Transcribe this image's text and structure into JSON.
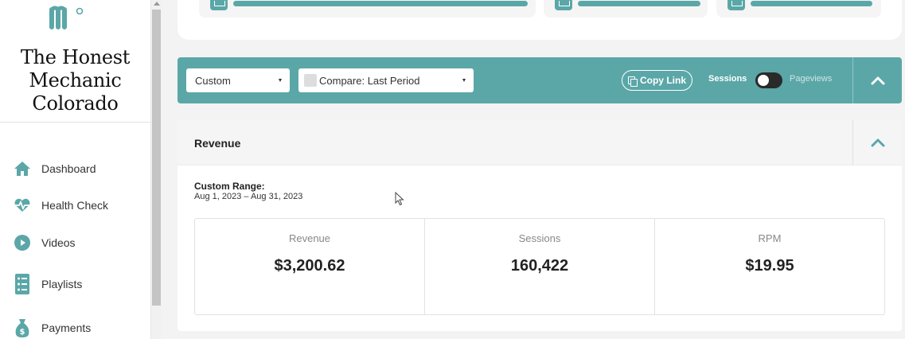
{
  "sidebar": {
    "site_title": "The Honest Mechanic Colorado",
    "nav": [
      {
        "label": "Dashboard",
        "icon": "home-icon"
      },
      {
        "label": "Health Check",
        "icon": "heartbeat-icon"
      },
      {
        "label": "Videos",
        "icon": "play-circle-icon"
      },
      {
        "label": "Playlists",
        "icon": "list-icon"
      },
      {
        "label": "Payments",
        "icon": "money-bag-icon"
      }
    ]
  },
  "toolbar": {
    "date_select": "Custom",
    "compare_select": "Compare: Last Period",
    "copy_link": "Copy Link",
    "toggle_left": "Sessions",
    "toggle_right": "Pageviews"
  },
  "revenue_panel": {
    "title": "Revenue",
    "range_label": "Custom Range:",
    "range_value": "Aug 1, 2023 – Aug 31, 2023",
    "stats": [
      {
        "label": "Revenue",
        "value": "$3,200.62"
      },
      {
        "label": "Sessions",
        "value": "160,422"
      },
      {
        "label": "RPM",
        "value": "$19.95"
      }
    ]
  },
  "colors": {
    "accent": "#5ba7a8",
    "toggle_track": "#2a2a2a"
  }
}
